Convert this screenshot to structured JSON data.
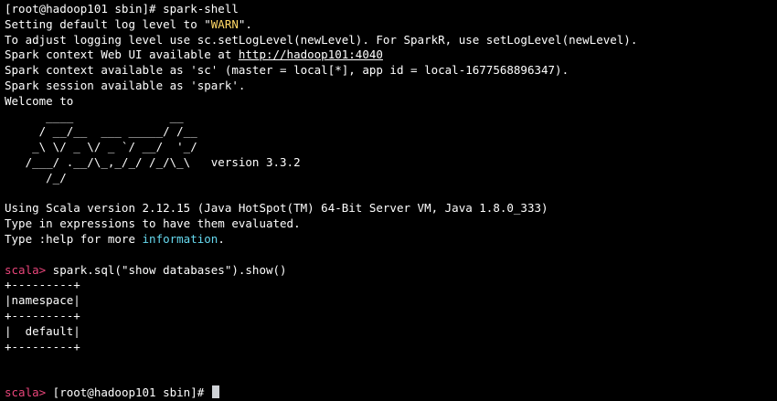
{
  "terminal": {
    "line1": "[root@hadoop101 sbin]# spark-shell",
    "line2": {
      "before": "Setting default log level to \"",
      "warn": "WARN",
      "after": "\"."
    },
    "line3": "To adjust logging level use sc.setLogLevel(newLevel). For SparkR, use setLogLevel(newLevel).",
    "line4": {
      "before": "Spark context Web UI available at ",
      "link": "http://hadoop101:4040"
    },
    "line5": "Spark context available as 'sc' (master = local[*], app id = local-1677568896347).",
    "line6": "Spark session available as 'spark'.",
    "line7": "Welcome to",
    "logo": [
      "      ____              __",
      "     / __/__  ___ _____/ /__",
      "    _\\ \\/ _ \\/ _ `/ __/  '_/",
      "   /___/ .__/\\_,_/_/ /_/\\_\\   version 3.3.2",
      "      /_/"
    ],
    "line13": "Using Scala version 2.12.15 (Java HotSpot(TM) 64-Bit Server VM, Java 1.8.0_333)",
    "line14": "Type in expressions to have them evaluated.",
    "line15": {
      "before": "Type :help for more ",
      "info": "information",
      "after": "."
    },
    "prompt": "scala>",
    "command": " spark.sql(\"show databases\").show()",
    "table": [
      "+---------+",
      "|namespace|",
      "+---------+",
      "|  default|",
      "+---------+"
    ],
    "last_input": " [root@hadoop101 sbin]# "
  },
  "colors": {
    "background": "#000000",
    "text": "#ffffff",
    "warn": "#ffd866",
    "prompt": "#e8457a",
    "info": "#66d9ef",
    "cursor": "#cfd2d6"
  }
}
